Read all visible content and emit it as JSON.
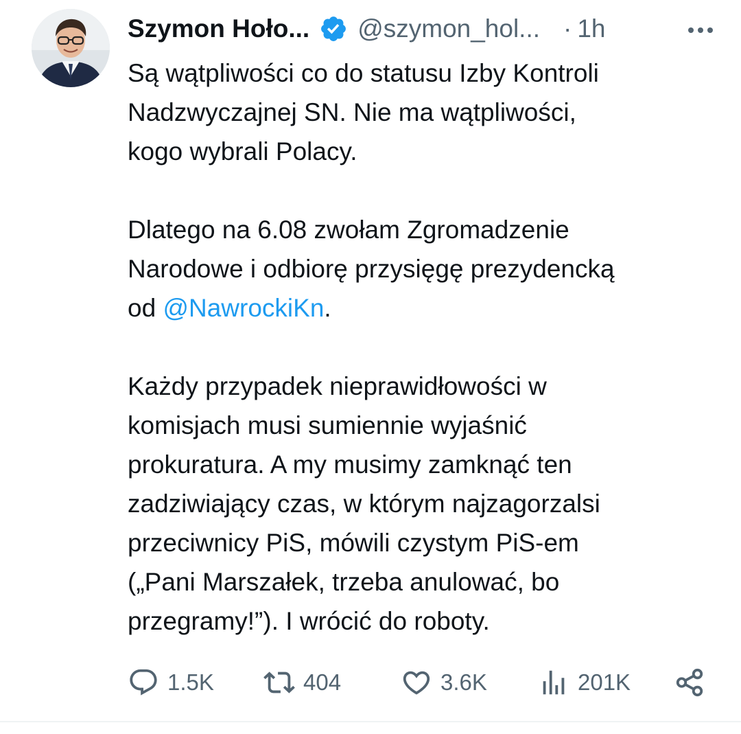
{
  "tweet": {
    "author_name": "Szymon Hoło...",
    "handle": "@szymon_hol...",
    "separator": "·",
    "time": "1h",
    "verified": true,
    "paragraphs": [
      {
        "lines": [
          "Są wątpliwości co do statusu Izby Kontroli",
          "Nadzwyczajnej SN. Nie ma wątpliwości,",
          "kogo wybrali Polacy."
        ]
      },
      {
        "lines": [
          "Dlatego na 6.08 zwołam Zgromadzenie",
          "Narodowe i odbiorę przysięgę prezydencką"
        ],
        "last_prefix": "od ",
        "mention": "@NawrockiKn",
        "last_suffix": "."
      },
      {
        "lines": [
          "Każdy przypadek nieprawidłowości w",
          "komisjach musi sumiennie wyjaśnić",
          "prokuratura. A my musimy zamknąć ten",
          "zadziwiający czas, w którym najzagorzalsi",
          "przeciwnicy PiS, mówili czystym PiS-em",
          "(„Pani Marszałek, trzeba anulować, bo",
          "przegramy!”). I wrócić do roboty."
        ]
      }
    ],
    "actions": {
      "replies": "1.5K",
      "reposts": "404",
      "likes": "3.6K",
      "views": "201K"
    }
  },
  "icons": {
    "verified": "verified-badge-icon",
    "more": "more-dots-icon",
    "reply": "reply-bubble-icon",
    "repost": "repost-arrows-icon",
    "like": "heart-icon",
    "views": "views-bars-icon",
    "share": "share-icon"
  },
  "colors": {
    "text": "#0f1419",
    "secondary": "#536471",
    "accent": "#1d9bf0",
    "divider": "#eff3f4"
  }
}
